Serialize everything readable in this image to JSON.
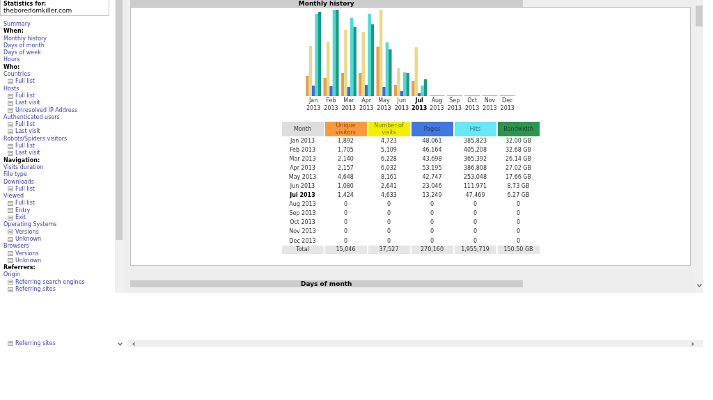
{
  "sidebar": {
    "title": "Statistics for:",
    "site": "theboredomkiller.com",
    "items": [
      {
        "kind": "link",
        "text": "Summary"
      },
      {
        "kind": "heading",
        "text": "When:"
      },
      {
        "kind": "link",
        "text": "Monthly history"
      },
      {
        "kind": "link",
        "text": "Days of month"
      },
      {
        "kind": "link",
        "text": "Days of week"
      },
      {
        "kind": "link",
        "text": "Hours"
      },
      {
        "kind": "heading",
        "text": "Who:"
      },
      {
        "kind": "link",
        "text": "Countries",
        "children": [
          {
            "text": "Full list"
          }
        ]
      },
      {
        "kind": "link",
        "text": "Hosts",
        "children": [
          {
            "text": "Full list"
          },
          {
            "text": "Last visit"
          },
          {
            "text": "Unresolved IP Address"
          }
        ]
      },
      {
        "kind": "link",
        "text": "Authenticated users",
        "children": [
          {
            "text": "Full list"
          },
          {
            "text": "Last visit"
          }
        ]
      },
      {
        "kind": "link",
        "text": "Robots/Spiders visitors",
        "children": [
          {
            "text": "Full list"
          },
          {
            "text": "Last visit"
          }
        ]
      },
      {
        "kind": "heading",
        "text": "Navigation:"
      },
      {
        "kind": "link",
        "text": "Visits duration"
      },
      {
        "kind": "link",
        "text": "File type"
      },
      {
        "kind": "link",
        "text": "Downloads",
        "children": [
          {
            "text": "Full list"
          }
        ]
      },
      {
        "kind": "link",
        "text": "Viewed",
        "children": [
          {
            "text": "Full list"
          },
          {
            "text": "Entry"
          },
          {
            "text": "Exit"
          }
        ]
      },
      {
        "kind": "link",
        "text": "Operating Systems",
        "children": [
          {
            "text": "Versions"
          },
          {
            "text": "Unknown"
          }
        ]
      },
      {
        "kind": "link",
        "text": "Browsers",
        "children": [
          {
            "text": "Versions"
          },
          {
            "text": "Unknown"
          }
        ]
      },
      {
        "kind": "heading",
        "text": "Referrers:"
      },
      {
        "kind": "link",
        "text": "Origin",
        "children": [
          {
            "text": "Referring search engines"
          },
          {
            "text": "Referring sites"
          }
        ]
      }
    ]
  },
  "monthly_history": {
    "title": "Monthly history",
    "chart": {
      "series": [
        {
          "color": "#e3a050"
        },
        {
          "color": "#e8d98c"
        },
        {
          "color": "#3d6cd6"
        },
        {
          "color": "#4fdad6"
        },
        {
          "color": "#1a9a80"
        }
      ],
      "labels": [
        {
          "month": "Jan",
          "year": "2013",
          "current": false
        },
        {
          "month": "Feb",
          "year": "2013",
          "current": false
        },
        {
          "month": "Mar",
          "year": "2013",
          "current": false
        },
        {
          "month": "Apr",
          "year": "2013",
          "current": false
        },
        {
          "month": "May",
          "year": "2013",
          "current": false
        },
        {
          "month": "Jun",
          "year": "2013",
          "current": false
        },
        {
          "month": "Jul",
          "year": "2013",
          "current": true
        },
        {
          "month": "Aug",
          "year": "2013",
          "current": false
        },
        {
          "month": "Sep",
          "year": "2013",
          "current": false
        },
        {
          "month": "Oct",
          "year": "2013",
          "current": false
        },
        {
          "month": "Nov",
          "year": "2013",
          "current": false
        },
        {
          "month": "Dec",
          "year": "2013",
          "current": false
        }
      ]
    },
    "table": {
      "columns": [
        {
          "label": "Month"
        },
        {
          "label": "Unique visitors",
          "color": "#ff9a3c"
        },
        {
          "label": "Number of visits",
          "color": "#f0f000"
        },
        {
          "label": "Pages",
          "color": "#4477dd"
        },
        {
          "label": "Hits",
          "color": "#66e8f8"
        },
        {
          "label": "Bandwidth",
          "color": "#2e9450"
        }
      ],
      "rows": [
        {
          "cells": [
            "Jan 2013",
            "1,892",
            "4,723",
            "48,061",
            "385,823",
            "32.00 GB"
          ],
          "current": false
        },
        {
          "cells": [
            "Feb 2013",
            "1,705",
            "5,109",
            "46,164",
            "405,208",
            "32.68 GB"
          ],
          "current": false
        },
        {
          "cells": [
            "Mar 2013",
            "2,140",
            "6,228",
            "43,698",
            "365,392",
            "26.14 GB"
          ],
          "current": false
        },
        {
          "cells": [
            "Apr 2013",
            "2,157",
            "6,032",
            "53,195",
            "386,808",
            "27.02 GB"
          ],
          "current": false
        },
        {
          "cells": [
            "May 2013",
            "4,648",
            "8,161",
            "42,747",
            "253,048",
            "17.66 GB"
          ],
          "current": false
        },
        {
          "cells": [
            "Jun 2013",
            "1,080",
            "2,641",
            "23,046",
            "111,971",
            "8.73 GB"
          ],
          "current": false
        },
        {
          "cells": [
            "Jul 2013",
            "1,424",
            "4,633",
            "13,249",
            "47,469",
            "6.27 GB"
          ],
          "current": true
        },
        {
          "cells": [
            "Aug 2013",
            "0",
            "0",
            "0",
            "0",
            "0"
          ],
          "current": false
        },
        {
          "cells": [
            "Sep 2013",
            "0",
            "0",
            "0",
            "0",
            "0"
          ],
          "current": false
        },
        {
          "cells": [
            "Oct 2013",
            "0",
            "0",
            "0",
            "0",
            "0"
          ],
          "current": false
        },
        {
          "cells": [
            "Nov 2013",
            "0",
            "0",
            "0",
            "0",
            "0"
          ],
          "current": false
        },
        {
          "cells": [
            "Dec 2013",
            "0",
            "0",
            "0",
            "0",
            "0"
          ],
          "current": false
        }
      ],
      "total": [
        "Total",
        "15,046",
        "37,527",
        "270,160",
        "1,955,719",
        "150.50 GB"
      ]
    }
  },
  "days_of_month": {
    "title": "Days of month"
  },
  "sidebar_overflow": {
    "text": "Referring sites"
  }
}
